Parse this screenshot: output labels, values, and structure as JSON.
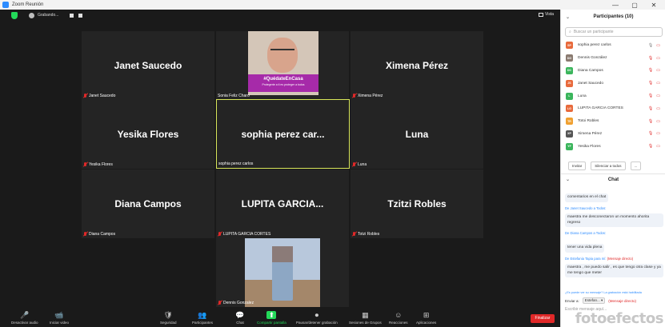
{
  "window": {
    "title": "Zoom Reunión",
    "controls": [
      "—",
      "▢",
      "✕"
    ]
  },
  "topbar": {
    "recording_label": "Grabando...",
    "view_label": "Vista"
  },
  "tiles": [
    {
      "name": "Janet Saucedo",
      "label": "Janet Saucedo",
      "muted": true
    },
    {
      "name": "",
      "label": "Sonia Feliz Charo",
      "muted": false,
      "banner": "#QuédateEnCasa",
      "banner_sub": "Protegerte a ti es proteger a todos"
    },
    {
      "name": "Ximena Pérez",
      "label": "Ximena Pérez",
      "muted": true
    },
    {
      "name": "Yesika Flores",
      "label": "Yesika Flores",
      "muted": true
    },
    {
      "name": "sophia perez car...",
      "label": "sophia perez carlos",
      "muted": false,
      "active": true
    },
    {
      "name": "Luna",
      "label": "Luna",
      "muted": true
    },
    {
      "name": "Diana Campos",
      "label": "Diana Campos",
      "muted": true
    },
    {
      "name": "LUPITA GARCIA...",
      "label": "LUPITA GARCIA CORTES",
      "muted": true
    },
    {
      "name": "Tzitzi Robles",
      "label": "Totzi Robles",
      "muted": true
    },
    {
      "name": "",
      "label": "Dennis Gonzalez",
      "muted": true
    }
  ],
  "toolbar": {
    "items": [
      {
        "icon": "🎤",
        "label": "Desactivar audio",
        "chev": "^"
      },
      {
        "icon": "📹",
        "label": "Iniciar video",
        "chev": "^"
      },
      {
        "icon": "🛡",
        "label": "Seguridad"
      },
      {
        "icon": "👥",
        "label": "Participantes",
        "count": "10"
      },
      {
        "icon": "💬",
        "label": "Chat"
      },
      {
        "icon": "⬆",
        "label": "Compartir pantalla"
      },
      {
        "icon": "⏺",
        "label": "Pausar/detener grabación"
      },
      {
        "icon": "▦",
        "label": "Sesiones de Grupos"
      },
      {
        "icon": "☺",
        "label": "Reacciones"
      },
      {
        "icon": "⊞",
        "label": "Aplicaciones"
      }
    ],
    "end_label": "Finalizar"
  },
  "participants_panel": {
    "title": "Participantes (10)",
    "search_placeholder": "Buscar un participante",
    "people": [
      {
        "initials": "SP",
        "name": "sophia perez carlos",
        "color": "#e86a3c",
        "mic_on": true
      },
      {
        "initials": "DG",
        "name": "Dennis González",
        "color": "#8a7a70",
        "mic_on": false
      },
      {
        "initials": "DC",
        "name": "Diana Campos",
        "color": "#3bb55c",
        "mic_on": false
      },
      {
        "initials": "JS",
        "name": "Janet Saucedo",
        "color": "#e86a3c",
        "mic_on": false
      },
      {
        "initials": "L",
        "name": "Luna",
        "color": "#3bb55c",
        "mic_on": false
      },
      {
        "initials": "LG",
        "name": "LUPITA GARCIA CORTES",
        "color": "#e86a3c",
        "mic_on": false
      },
      {
        "initials": "TR",
        "name": "Totoi Robles",
        "color": "#f0a030",
        "mic_on": false
      },
      {
        "initials": "XP",
        "name": "Ximena Pérez",
        "color": "#555555",
        "mic_on": false
      },
      {
        "initials": "YF",
        "name": "Yesika Flores",
        "color": "#3bb55c",
        "mic_on": false
      }
    ],
    "invite_label": "Invitar",
    "mute_all_label": "Silenciar a todos",
    "more_label": "..."
  },
  "chat_panel": {
    "title": "Chat",
    "messages": [
      {
        "from": "",
        "text": "comentarios en el chat"
      },
      {
        "from": "De Janet Saucedo a Todos:",
        "text": "maestra me desconectaron un momento ahorita regreso"
      },
      {
        "from": "De Diana Campos a Todos:",
        "text": "tener una vida plena"
      },
      {
        "from": "De Estefania Tapia para mí:",
        "private": "(Mensaje directo)",
        "text": "maestra , me puedo salir , es que tengo otra clase y ya me tengo que meter"
      }
    ],
    "warning": "¿Es puede ver su mensaje? La grabación está habilitada",
    "send_to_label": "Enviar a:",
    "send_to_value": "Estefan... ▾",
    "send_to_private": "(Mensaje directo)",
    "input_placeholder": "Escribir mensaje aquí..."
  },
  "watermark": "fotoefectos"
}
